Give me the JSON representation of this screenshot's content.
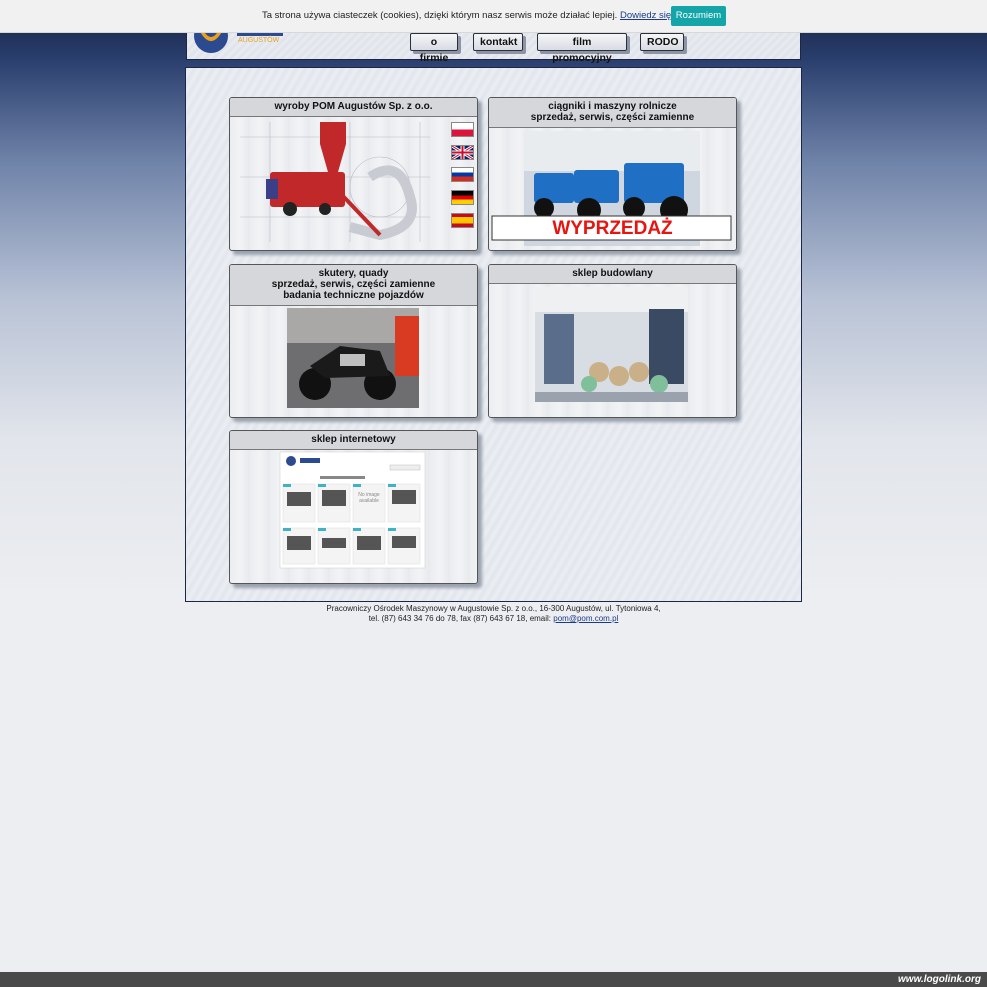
{
  "cookie": {
    "text": "Ta strona używa ciasteczek (cookies), dzięki którym nasz serwis może działać lepiej.",
    "link": "Dowiedz się więcej",
    "button": "Rozumiem"
  },
  "header": {
    "logo_text": "AUGUSTÓW",
    "nav": [
      "o firmie",
      "kontakt",
      "film promocyjny",
      "RODO"
    ]
  },
  "cards": {
    "products": {
      "title": "wyroby POM Augustów Sp. z o.o."
    },
    "tractors": {
      "title_1": "ciągniki i maszyny rolnicze",
      "title_2": "sprzedaż, serwis, części zamienne",
      "sale": "WYPRZEDAŻ"
    },
    "scooters": {
      "title_1": "skutery, quady",
      "title_2": "sprzedaż, serwis, części zamienne",
      "title_3": "badania techniczne pojazdów"
    },
    "building": {
      "title": "sklep budowlany"
    },
    "eshop": {
      "title": "sklep internetowy",
      "no_image": "No image available"
    }
  },
  "flags": [
    "flag-pl-icon",
    "flag-gb-icon",
    "flag-ru-icon",
    "flag-de-icon",
    "flag-es-icon"
  ],
  "footer": {
    "line1": "Pracowniczy Ośrodek Maszynowy w Augustowie Sp. z o.o., 16-300 Augustów, ul. Tytoniowa 4,",
    "line2": "tel. (87) 643 34 76 do 78, fax (87) 643 67 18, email:",
    "email": "pom@pom.com.pl"
  },
  "watermark": "www.logolink.org",
  "colors": {
    "cookie_button": "#13a5a7",
    "sale_red": "#e8140f",
    "frame": "#1c2747"
  }
}
